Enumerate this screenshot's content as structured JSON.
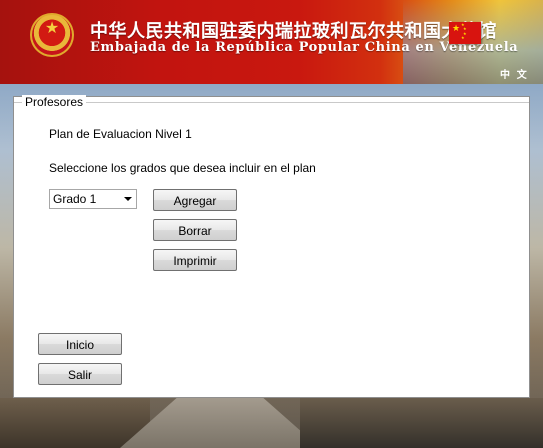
{
  "header": {
    "title_cn": "中华人民共和国驻委内瑞拉玻利瓦尔共和国大使馆",
    "title_es": "Embajada de la República Popular China en Venezuela",
    "lang_link": "中 文",
    "emblem_icon": "national-emblem-icon",
    "flag_icon": "china-flag-icon",
    "colors": {
      "banner_red": "#c2140f",
      "accent_gold": "#f0c43a"
    }
  },
  "form": {
    "group_title": "Profesores",
    "plan_title": "Plan de Evaluacion Nivel 1",
    "instruction": "Seleccione los grados que desea incluir en el plan",
    "grade_select": {
      "selected": "Grado 1",
      "icon": "chevron-down-icon"
    },
    "buttons": {
      "agregar": "Agregar",
      "borrar": "Borrar",
      "imprimir": "Imprimir",
      "inicio": "Inicio",
      "salir": "Salir"
    }
  }
}
